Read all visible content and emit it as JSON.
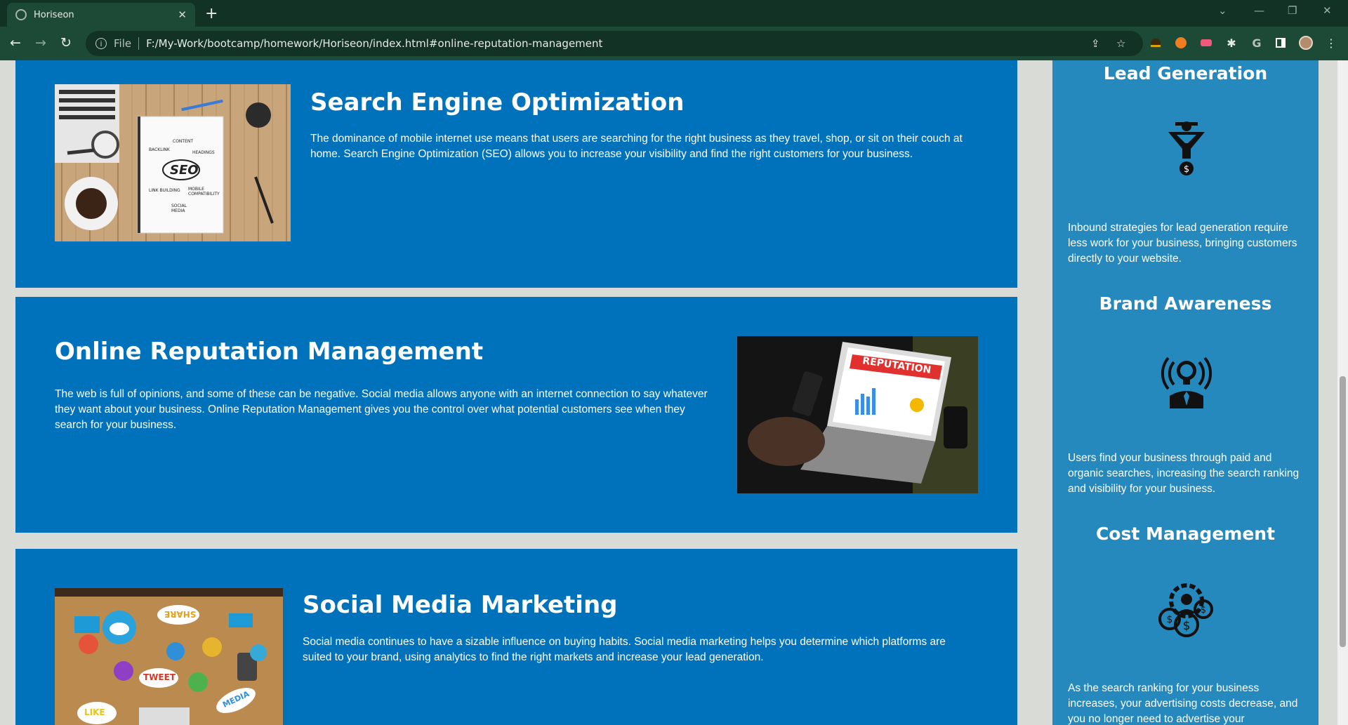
{
  "browser": {
    "tab_title": "Horiseon",
    "scheme_label": "File",
    "url": "F:/My-Work/bootcamp/homework/Horiseon/index.html#online-reputation-management"
  },
  "sections": [
    {
      "title": "Search Engine Optimization",
      "body": "The dominance of mobile internet use means that users are searching for the right business as they travel, shop, or sit on their couch at home. Search Engine Optimization (SEO) allows you to increase your visibility and find the right customers for your business.",
      "image_labels": {
        "seo": "SEO",
        "content": "CONTENT",
        "backlink": "BACKLINK",
        "headings": "HEADINGS",
        "link_building": "LINK BUILDING",
        "mobile": "MOBILE COMPATIBILITY",
        "social": "SOCIAL MEDIA"
      }
    },
    {
      "title": "Online Reputation Management",
      "body": "The web is full of opinions, and some of these can be negative. Social media allows anyone with an internet connection to say whatever they want about your business. Online Reputation Management gives you the control over what potential customers see when they search for your business.",
      "image_labels": {
        "banner": "REPUTATION"
      }
    },
    {
      "title": "Social Media Marketing",
      "body": "Social media continues to have a sizable influence on buying habits. Social media marketing helps you determine which platforms are suited to your brand, using analytics to find the right markets and increase your lead generation.",
      "image_labels": {
        "share": "SHARE",
        "tweet": "TWEET",
        "like": "LIKE",
        "media": "MEDIA"
      }
    }
  ],
  "benefits": [
    {
      "title": "Lead Generation",
      "icon": "lead-funnel-icon",
      "body": "Inbound strategies for lead generation require less work for your business, bringing customers directly to your website."
    },
    {
      "title": "Brand Awareness",
      "icon": "brand-lightbulb-icon",
      "body": "Users find your business through paid and organic searches, increasing the search ranking and visibility for your business."
    },
    {
      "title": "Cost Management",
      "icon": "cost-coins-icon",
      "body": "As the search ranking for your business increases, your advertising costs decrease, and you no longer need to advertise your"
    }
  ],
  "colors": {
    "card_blue": "#0072bb",
    "aside_blue": "#2589bd",
    "page_bg": "#d9dcd6"
  }
}
